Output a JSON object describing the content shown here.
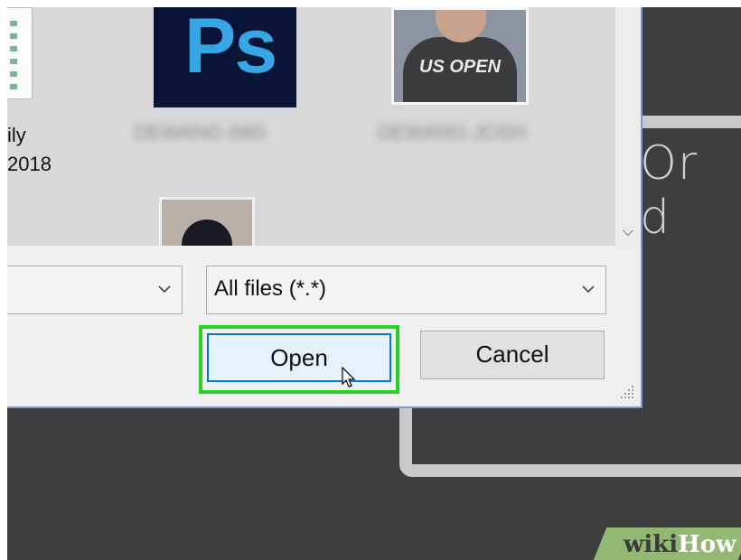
{
  "background": {
    "partial_text": "Or d"
  },
  "dialog": {
    "files": [
      {
        "label_line1": "ily",
        "label_line2": "2018",
        "type": "spreadsheet"
      },
      {
        "label": "DEWANG-IMG",
        "type": "photoshop",
        "thumb_text": "Ps"
      },
      {
        "label": "DEWANG-JOSH",
        "type": "photo",
        "shirt_text": "US OPEN"
      },
      {
        "label": "",
        "type": "photo"
      }
    ],
    "filename_input": {
      "value": ""
    },
    "filetype_select": {
      "value": "All files (*.*)"
    },
    "open_label": "Open",
    "cancel_label": "Cancel"
  },
  "watermark": {
    "wiki": "wiki",
    "how": "How"
  },
  "colors": {
    "highlight": "#24d424",
    "open_border": "#0078d7",
    "ps_blue": "#36a6e6",
    "ps_bg": "#0a1437"
  }
}
